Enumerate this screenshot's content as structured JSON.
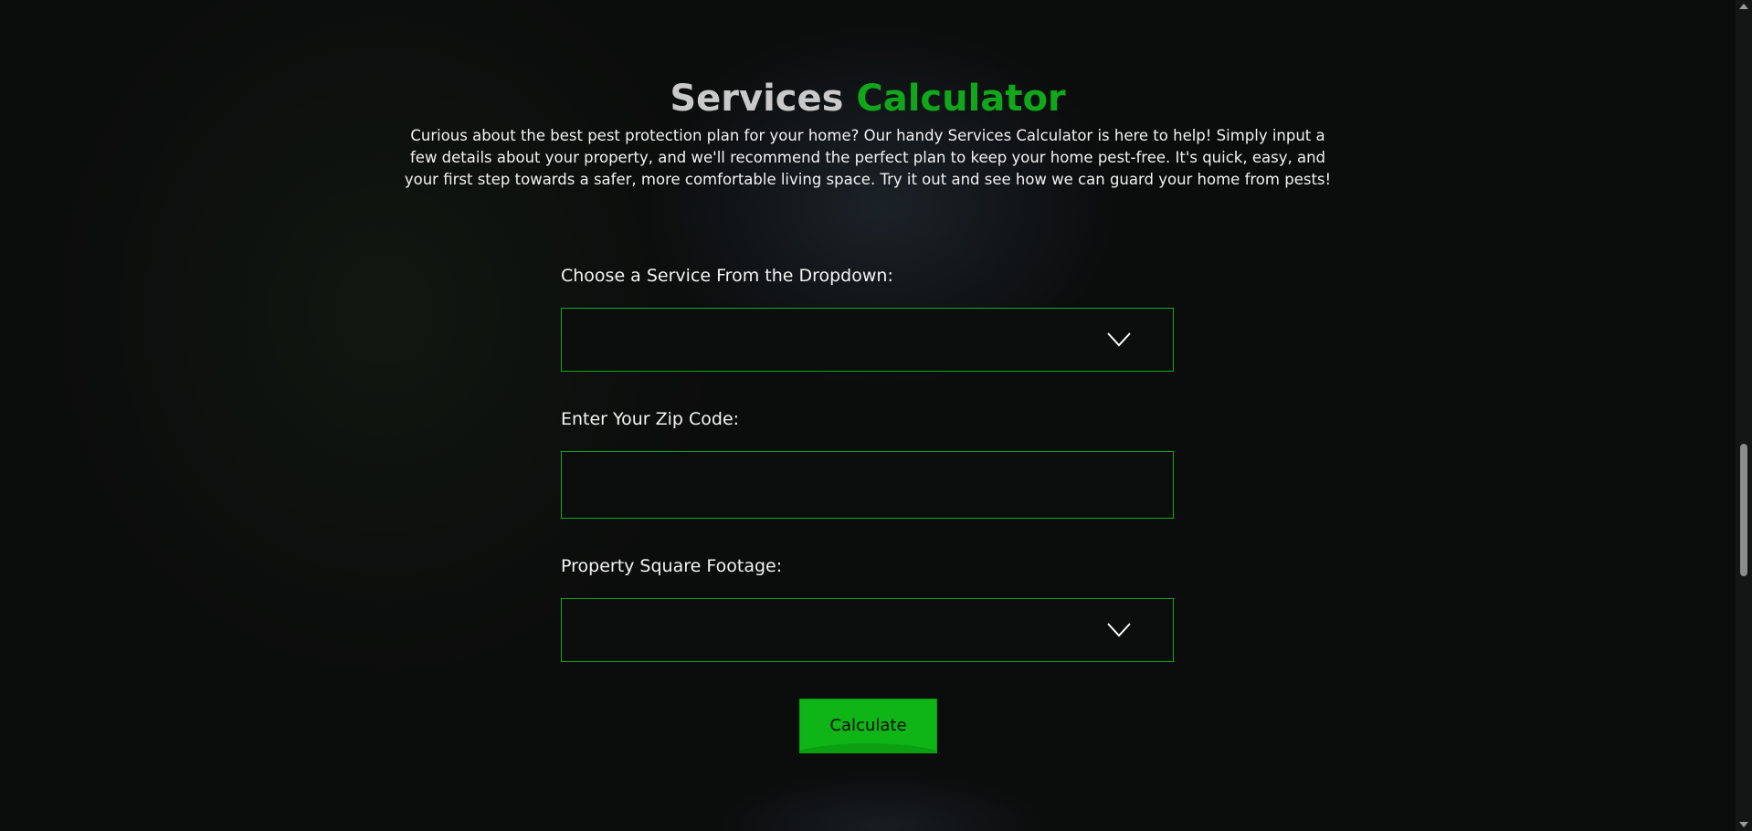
{
  "header": {
    "title_part1": "Services",
    "title_part2": "Calculator",
    "intro": "Curious about the best pest protection plan for your home? Our handy Services Calculator is here to help! Simply input a few details about your property, and we'll recommend the perfect plan to keep your home pest-free. It's quick, easy, and your first step towards a safer, more comfortable living space. Try it out and see how we can guard your home from pests!"
  },
  "form": {
    "service": {
      "label": "Choose a Service From the Dropdown:",
      "value": "",
      "icon": "chevron-down-icon"
    },
    "zip": {
      "label": "Enter Your Zip Code:",
      "value": "",
      "placeholder": ""
    },
    "footage": {
      "label": "Property Square Footage:",
      "value": "",
      "icon": "chevron-down-icon"
    },
    "submit_label": "Calculate"
  },
  "colors": {
    "accent": "#11a71b",
    "button": "#0fb516",
    "background": "#0b0c0c"
  }
}
